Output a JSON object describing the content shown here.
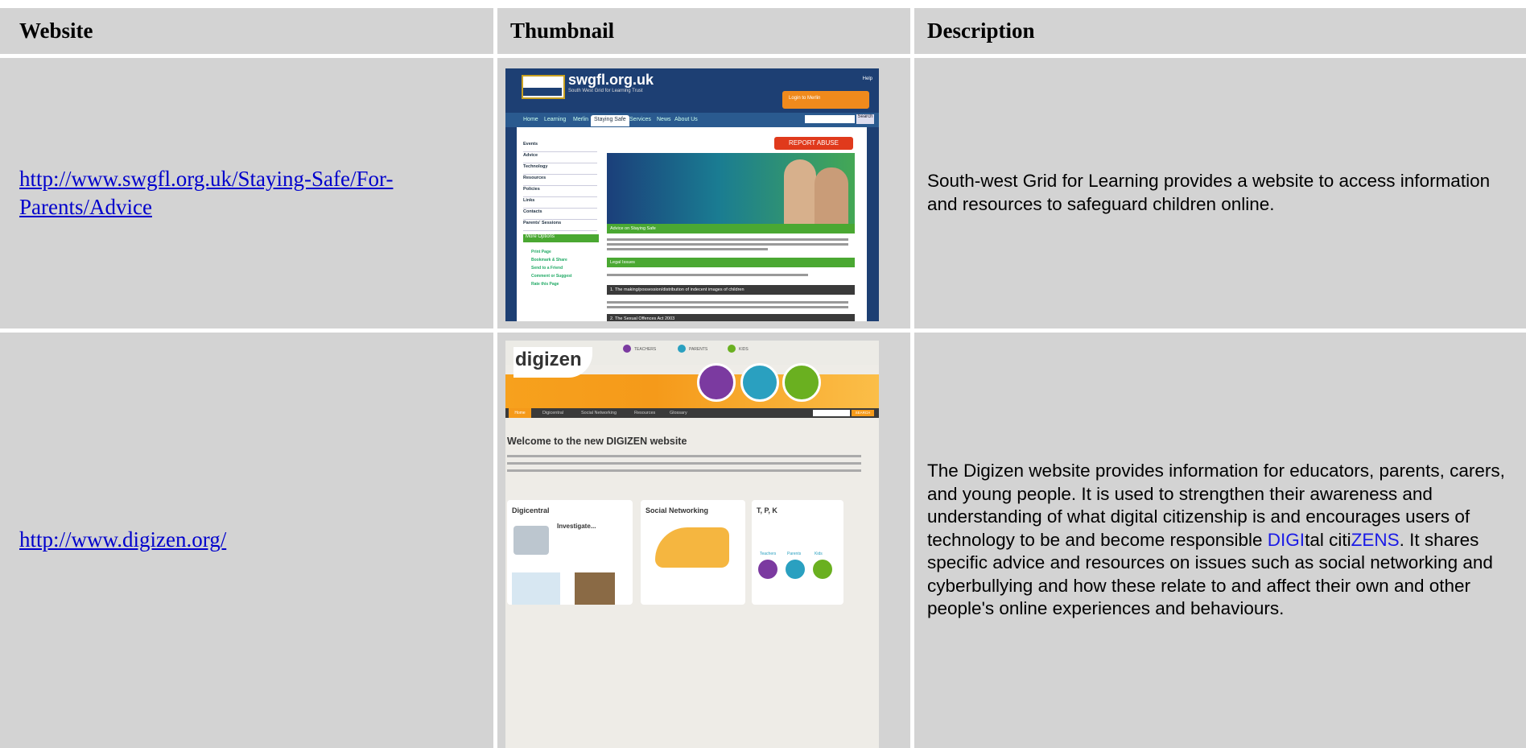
{
  "table": {
    "headers": [
      "Website",
      "Thumbnail",
      "Description"
    ],
    "rows": [
      {
        "url_line1": "http://www.swgfl.org.uk/Staying-Safe/For-",
        "url_line2": "Parents/Advice",
        "description": "South-west Grid for Learning provides a website to access information and resources to safeguard children online.",
        "thumbnail": {
          "site_title": "swgfl.org.uk",
          "site_subtitle": "South West Grid for Learning Trust",
          "help": "Help",
          "login": "Login to Merlin",
          "nav": [
            "Home",
            "Learning",
            "Merlin",
            "Staying Safe",
            "Services",
            "News",
            "About Us"
          ],
          "search_button": "Search",
          "sidebar": [
            "Events",
            "Advice",
            "Technology",
            "Resources",
            "Policies",
            "Links",
            "Contacts",
            "Parents' Sessions"
          ],
          "more_options": "More Options",
          "options": [
            "Print Page",
            "Bookmark & Share",
            "Send to a Friend",
            "Comment or Suggest",
            "Rate this Page"
          ],
          "report_abuse": "REPORT ABUSE",
          "advice_bar": "Advice on Staying Safe",
          "legal_bar": "Legal Issues",
          "issue1": "1. The making/possession/distribution of indecent images of children",
          "issue2": "2. The Sexual Offences Act 2003"
        }
      },
      {
        "url": "http://www.digizen.org/",
        "description_parts": [
          "The Digizen website provides information for educators, parents, carers, and young people. It is used to strengthen their awareness and understanding of what digital citizenship is and encourages users of technology to be and become responsible ",
          "DIGI",
          "tal citi",
          "ZENS",
          ". It shares specific advice and resources on issues such as social networking and cyberbullying and how these relate to and affect their own and other people's online experiences and behaviours."
        ],
        "thumbnail": {
          "logo": "digizen",
          "top_links": [
            "TEACHERS",
            "PARENTS",
            "KIDS"
          ],
          "nav": [
            "Home",
            "Digicentral",
            "Social Networking",
            "Resources",
            "Glossary"
          ],
          "search_button": "SEARCH",
          "welcome": "Welcome to the new DIGIZEN website",
          "panels": [
            "Digicentral",
            "Social Networking",
            "T, P, K"
          ],
          "investigate": "Investigate...",
          "tpk_links": [
            "Teachers",
            "Parents",
            "Kids"
          ]
        }
      }
    ]
  },
  "colors": {
    "cell_bg": "#d3d3d3",
    "link": "#0000cc",
    "highlight_blue": "#1a1ae6"
  }
}
